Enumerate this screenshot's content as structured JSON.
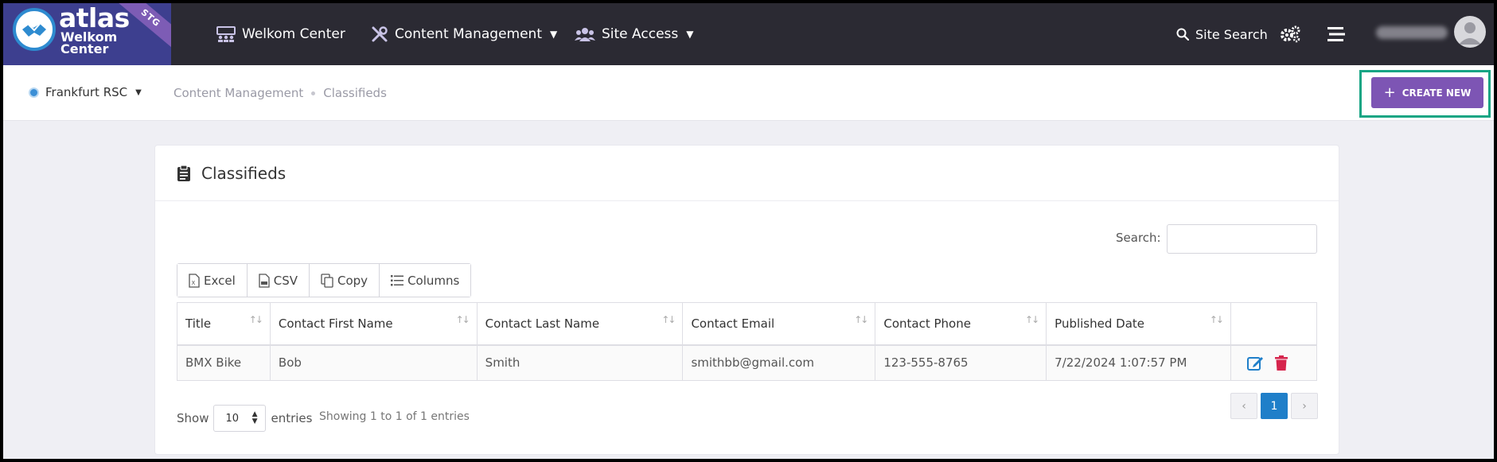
{
  "logo": {
    "word": "atlas",
    "line1": "Welkom",
    "line2": "Center",
    "env_badge": "STG"
  },
  "nav": {
    "items": [
      {
        "label": "Welkom Center",
        "icon": "people-board-icon"
      },
      {
        "label": "Content Management",
        "icon": "tools-icon"
      },
      {
        "label": "Site Access",
        "icon": "users-icon"
      }
    ],
    "site_search": "Site Search"
  },
  "subbar": {
    "site": "Frankfurt RSC",
    "breadcrumb": [
      "Content Management",
      "Classifieds"
    ],
    "create_label": "CREATE NEW"
  },
  "card": {
    "title": "Classifieds",
    "search_label": "Search:",
    "search_value": "",
    "export_buttons": [
      "Excel",
      "CSV",
      "Copy",
      "Columns"
    ],
    "table": {
      "headers": [
        "Title",
        "Contact First Name",
        "Contact Last Name",
        "Contact Email",
        "Contact Phone",
        "Published Date",
        ""
      ],
      "rows": [
        [
          "BMX Bike",
          "Bob",
          "Smith",
          "smithbb@gmail.com",
          "123-555-8765",
          "7/22/2024 1:07:57 PM"
        ]
      ]
    },
    "show_label": "Show",
    "entries_value": "10",
    "entries_label": "entries",
    "info": "Showing 1 to 1 of 1 entries",
    "pager": {
      "prev": "‹",
      "current": "1",
      "next": "›"
    }
  },
  "colors": {
    "accent": "#7d55b4",
    "highlight": "#16a584",
    "nav_bg": "#2b2a33",
    "edit": "#1f7fc9",
    "delete": "#d6254d"
  }
}
